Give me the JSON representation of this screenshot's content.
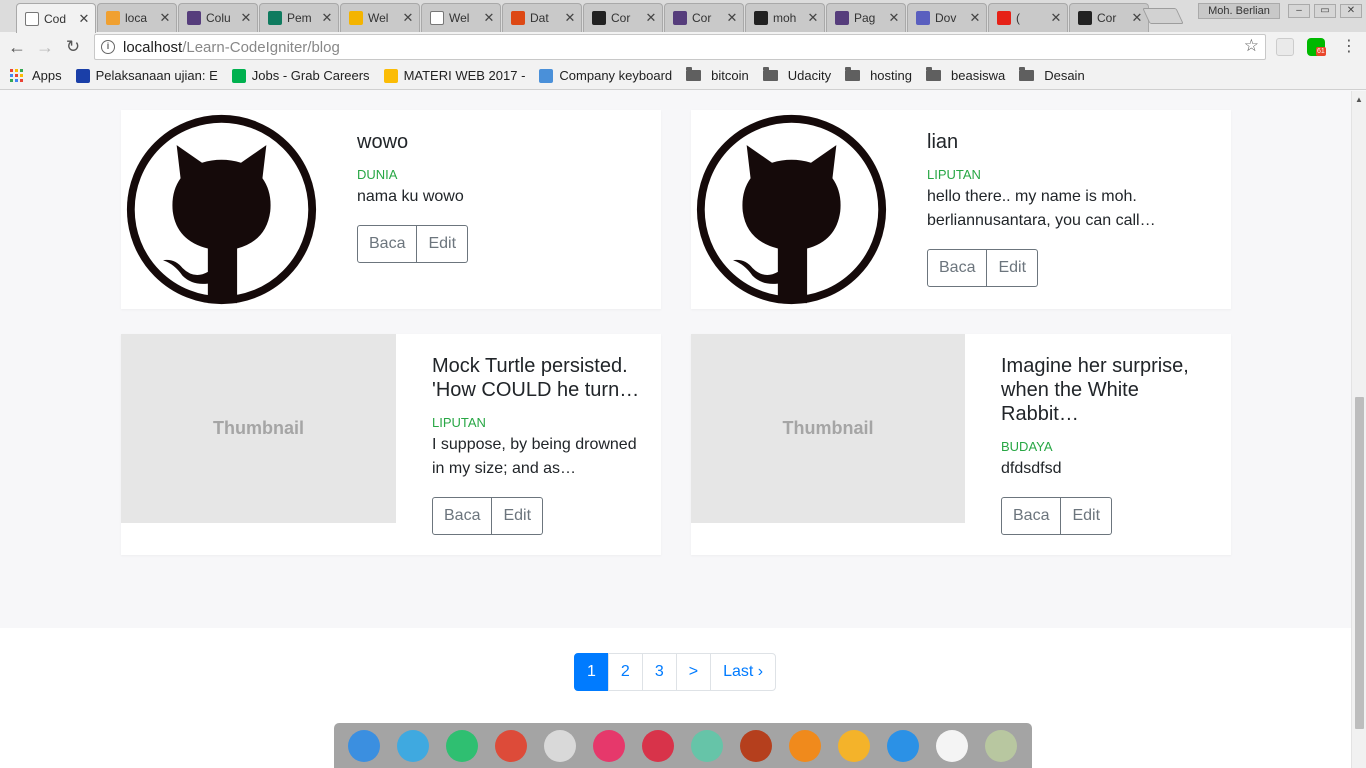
{
  "browser": {
    "tabs": [
      {
        "label": "Cod",
        "icon": "page-icon",
        "color": "#ffffff",
        "active": true
      },
      {
        "label": "loca",
        "icon": "phpmyadmin-icon",
        "color": "#f0a030"
      },
      {
        "label": "Colu",
        "icon": "bootstrap-icon",
        "color": "#563d7c"
      },
      {
        "label": "Pem",
        "icon": "classroom-icon",
        "color": "#0f7b5f"
      },
      {
        "label": "Wel",
        "icon": "slides-icon",
        "color": "#f4b400"
      },
      {
        "label": "Wel",
        "icon": "page-icon",
        "color": "#ffffff"
      },
      {
        "label": "Dat",
        "icon": "codeigniter-icon",
        "color": "#dd4814"
      },
      {
        "label": "Cor",
        "icon": "github-icon",
        "color": "#222222"
      },
      {
        "label": "Cor",
        "icon": "bootstrap-icon",
        "color": "#563d7c"
      },
      {
        "label": "moh",
        "icon": "github-icon",
        "color": "#222222"
      },
      {
        "label": "Pag",
        "icon": "bootstrap-icon",
        "color": "#563d7c"
      },
      {
        "label": "Dov",
        "icon": "globe-icon",
        "color": "#5a5fbf"
      },
      {
        "label": "(",
        "icon": "youtube-icon",
        "color": "#e62117"
      },
      {
        "label": "Cor",
        "icon": "github-icon",
        "color": "#222222"
      }
    ],
    "user_badge": "Moh. Berlian",
    "url_host": "localhost",
    "url_path": "/Learn-CodeIgniter/blog",
    "bookmarks": [
      {
        "label": "Apps",
        "type": "apps"
      },
      {
        "label": "Pelaksanaan ujian: E",
        "type": "site",
        "color": "#1a3fa8"
      },
      {
        "label": "Jobs - Grab Careers",
        "type": "site",
        "color": "#00b14f"
      },
      {
        "label": "MATERI WEB 2017 -",
        "type": "site",
        "color": "#fbbc05"
      },
      {
        "label": "Company keyboard",
        "type": "site",
        "color": "#4a90d9"
      },
      {
        "label": "bitcoin",
        "type": "folder"
      },
      {
        "label": "Udacity",
        "type": "folder"
      },
      {
        "label": "hosting",
        "type": "folder"
      },
      {
        "label": "beasiswa",
        "type": "folder"
      },
      {
        "label": "Desain",
        "type": "folder"
      }
    ],
    "line_badge": "61"
  },
  "posts": [
    {
      "title": "wowo",
      "category": "DUNIA",
      "desc": "nama ku wowo",
      "image": "github-octocat",
      "read": "Baca",
      "edit": "Edit"
    },
    {
      "title": "lian",
      "category": "LIPUTAN",
      "desc": "hello there.. my name is moh. berliannusantara, you can call…",
      "image": "github-octocat",
      "read": "Baca",
      "edit": "Edit"
    },
    {
      "title": "Mock Turtle persisted. 'How COULD he turn…",
      "category": "LIPUTAN",
      "desc": "I suppose, by being drowned in my size; and as…",
      "image": "Thumbnail",
      "read": "Baca",
      "edit": "Edit"
    },
    {
      "title": "Imagine her surprise, when the White Rabbit…",
      "category": "BUDAYA",
      "desc": "dfdsdfsd",
      "image": "Thumbnail",
      "read": "Baca",
      "edit": "Edit"
    }
  ],
  "pagination": [
    "1",
    "2",
    "3",
    ">",
    "Last ›"
  ],
  "pagination_active": "1",
  "dock": [
    {
      "name": "launcher-icon",
      "color": "#3b8fe0"
    },
    {
      "name": "file-manager-icon",
      "color": "#3fa9e0"
    },
    {
      "name": "terminal-green-icon",
      "color": "#2fbf71"
    },
    {
      "name": "chrome-icon",
      "color": "#dd4b39"
    },
    {
      "name": "settings-icon",
      "color": "#d9d9d9"
    },
    {
      "name": "screenshot-icon",
      "color": "#e6386b"
    },
    {
      "name": "terminal-icon",
      "color": "#d8334a"
    },
    {
      "name": "atom-icon",
      "color": "#66c4a8"
    },
    {
      "name": "brave-icon",
      "color": "#b53f1d"
    },
    {
      "name": "vlc-icon",
      "color": "#f08a1c"
    },
    {
      "name": "update-icon",
      "color": "#f4b32a"
    },
    {
      "name": "wifi-icon",
      "color": "#2b91e6"
    },
    {
      "name": "clock-icon",
      "color": "#f4f4f4"
    },
    {
      "name": "trash-icon",
      "color": "#b8c7a0"
    }
  ],
  "colors": {
    "accent": "#007bff",
    "category": "#28a745"
  }
}
